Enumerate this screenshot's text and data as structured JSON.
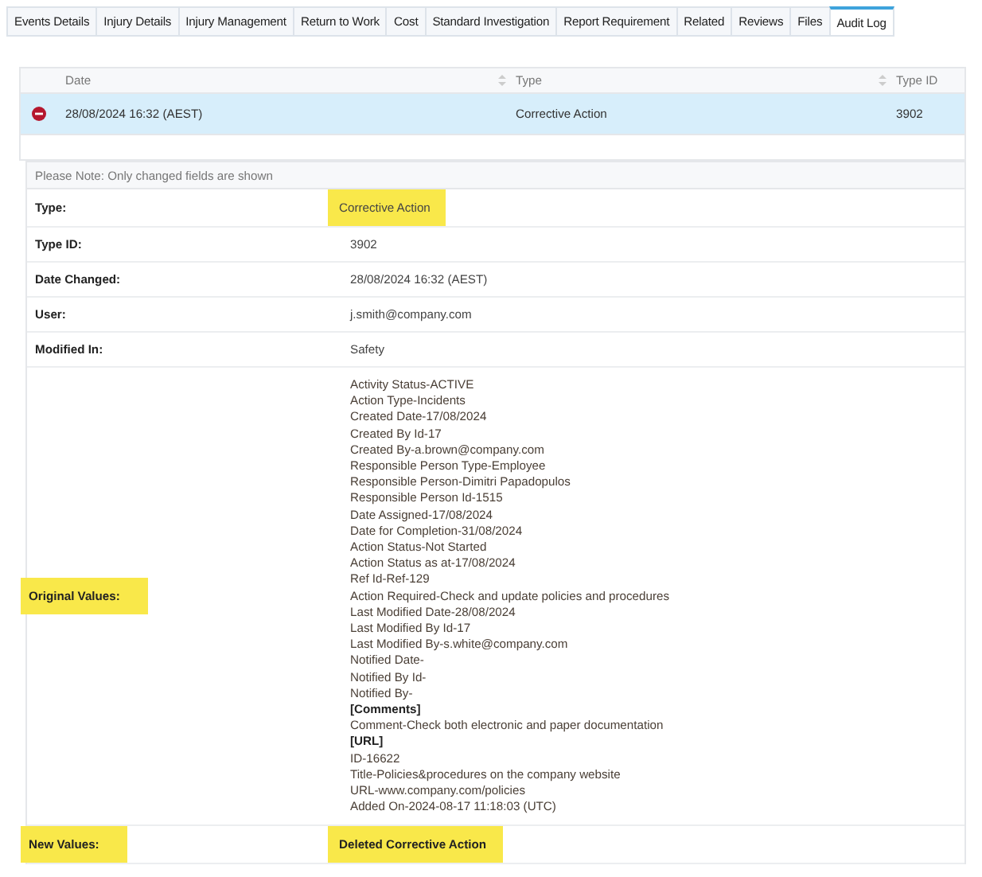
{
  "tabs": [
    {
      "label": "Events Details",
      "selected": false
    },
    {
      "label": "Injury Details",
      "selected": false
    },
    {
      "label": "Injury Management",
      "selected": false
    },
    {
      "label": "Return to Work",
      "selected": false
    },
    {
      "label": "Cost",
      "selected": false
    },
    {
      "label": "Standard Investigation",
      "selected": false
    },
    {
      "label": "Report Requirement",
      "selected": false
    },
    {
      "label": "Related",
      "selected": false
    },
    {
      "label": "Reviews",
      "selected": false
    },
    {
      "label": "Files",
      "selected": false
    },
    {
      "label": "Audit Log",
      "selected": true
    }
  ],
  "table": {
    "columns": [
      "Date",
      "Type",
      "Type ID"
    ],
    "rows": [
      {
        "date": "28/08/2024 16:32 (AEST)",
        "type": "Corrective Action",
        "type_id": "3902",
        "selected": true
      }
    ]
  },
  "details": {
    "note": "Please Note: Only changed fields are shown",
    "fields": [
      {
        "label": "Type:",
        "value": "Corrective Action",
        "label_highlighted": false,
        "value_highlighted": true
      },
      {
        "label": "Type ID:",
        "value": "3902",
        "label_highlighted": false,
        "value_highlighted": false
      },
      {
        "label": "Date Changed:",
        "value": "28/08/2024 16:32 (AEST)",
        "label_highlighted": false,
        "value_highlighted": false
      },
      {
        "label": "User:",
        "value": "j.smith@company.com",
        "label_highlighted": false,
        "value_highlighted": false
      },
      {
        "label": "Modified In:",
        "value": "Safety",
        "label_highlighted": false,
        "value_highlighted": false
      }
    ],
    "original_values": {
      "label": "Original Values:",
      "label_highlighted": true,
      "lines": [
        {
          "text": "Activity Status-ACTIVE",
          "kind": "line"
        },
        {
          "text": "Action Type-Incidents",
          "kind": "line"
        },
        {
          "text": "Created Date-17/08/2024",
          "kind": "line"
        },
        {
          "text": "Created By Id-17",
          "kind": "line"
        },
        {
          "text": "Created By-a.brown@company.com",
          "kind": "line"
        },
        {
          "text": "Responsible Person Type-Employee",
          "kind": "line"
        },
        {
          "text": "Responsible Person-Dimitri Papadopulos",
          "kind": "line"
        },
        {
          "text": "Responsible Person Id-1515",
          "kind": "line"
        },
        {
          "text": "Date Assigned-17/08/2024",
          "kind": "line"
        },
        {
          "text": "Date for Completion-31/08/2024",
          "kind": "line"
        },
        {
          "text": "Action Status-Not Started",
          "kind": "line"
        },
        {
          "text": "Action Status as at-17/08/2024",
          "kind": "line"
        },
        {
          "text": "Ref Id-Ref-129",
          "kind": "line"
        },
        {
          "text": "Action Required-Check and update policies and procedures",
          "kind": "line"
        },
        {
          "text": "Last Modified Date-28/08/2024",
          "kind": "line"
        },
        {
          "text": "Last Modified By Id-17",
          "kind": "line"
        },
        {
          "text": "Last Modified By-s.white@company.com",
          "kind": "line"
        },
        {
          "text": "Notified Date-",
          "kind": "line"
        },
        {
          "text": "Notified By Id-",
          "kind": "line"
        },
        {
          "text": "Notified By-",
          "kind": "line"
        },
        {
          "text": "[Comments]",
          "kind": "heading"
        },
        {
          "text": "Comment-Check both electronic and paper documentation",
          "kind": "line"
        },
        {
          "text": "[URL]",
          "kind": "heading"
        },
        {
          "text": "ID-16622",
          "kind": "line"
        },
        {
          "text": "Title-Policies&procedures on the company website",
          "kind": "line"
        },
        {
          "text": "URL-www.company.com/policies",
          "kind": "line"
        },
        {
          "text": "Added On-2024-08-17 11:18:03 (UTC)",
          "kind": "line"
        }
      ]
    },
    "new_values": {
      "label": "New Values:",
      "value": "Deleted Corrective Action",
      "label_highlighted": true,
      "value_highlighted": true
    }
  }
}
